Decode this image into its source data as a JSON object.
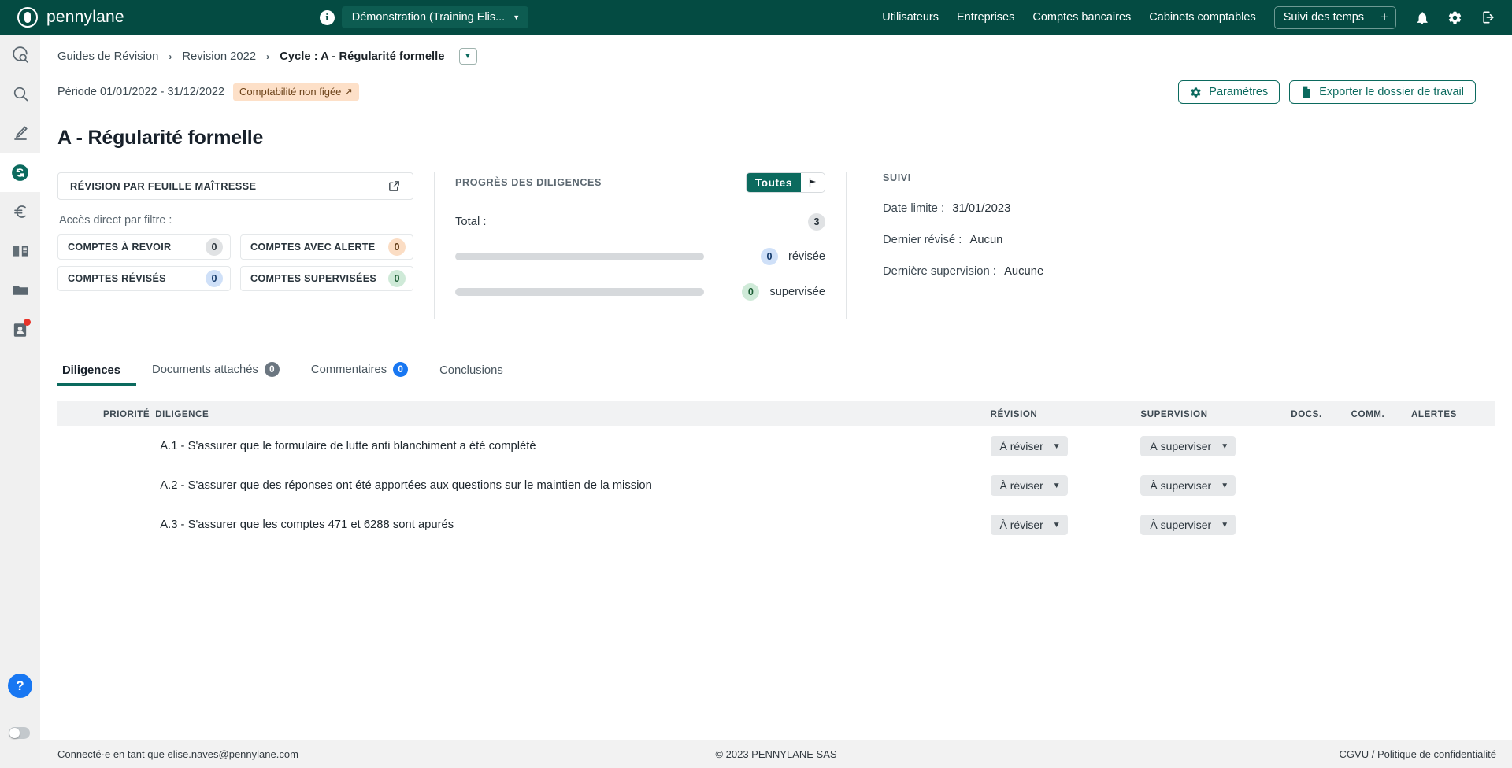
{
  "topbar": {
    "brand": "pennylane",
    "org_selector": "Démonstration (Training Elis...",
    "nav": [
      {
        "label": "Utilisateurs"
      },
      {
        "label": "Entreprises"
      },
      {
        "label": "Comptes bancaires"
      },
      {
        "label": "Cabinets comptables"
      }
    ],
    "time_tracking_label": "Suivi des temps",
    "time_tracking_plus": "+",
    "icons": [
      "info-icon",
      "bell-icon",
      "gear-icon",
      "logout-icon"
    ],
    "background": "#044b42"
  },
  "rail": {
    "items": [
      {
        "name": "review-search-icon",
        "active": false
      },
      {
        "name": "search-icon",
        "active": false
      },
      {
        "name": "pen-icon",
        "active": false
      },
      {
        "name": "revision-cycle-icon",
        "active": true
      },
      {
        "name": "euro-icon",
        "active": false
      },
      {
        "name": "book-icon",
        "active": false
      },
      {
        "name": "folder-icon",
        "active": false
      },
      {
        "name": "contact-icon",
        "active": false,
        "badge": true
      }
    ],
    "help_label": "?",
    "accent": "#0b6a5e"
  },
  "breadcrumb": {
    "items": [
      "Guides de Révision",
      "Revision 2022"
    ],
    "current": "Cycle : A - Régularité formelle",
    "separator": "›"
  },
  "period": {
    "text": "Période 01/01/2022 - 31/12/2022",
    "badge": "Comptabilité non figée ↗",
    "badge_color": "#fde0c8"
  },
  "actions": {
    "settings": "Paramètres",
    "export": "Exporter le dossier de travail"
  },
  "page_title": "A - Régularité formelle",
  "sheet_panel": {
    "title": "RÉVISION PAR FEUILLE MAÎTRESSE",
    "filter_label": "Accès direct par filtre :",
    "filters": [
      {
        "label": "COMPTES À REVOIR",
        "count": "0",
        "tone": "grey"
      },
      {
        "label": "COMPTES AVEC ALERTE",
        "count": "0",
        "tone": "orange"
      },
      {
        "label": "COMPTES RÉVISÉS",
        "count": "0",
        "tone": "blue"
      },
      {
        "label": "COMPTES SUPERVISÉES",
        "count": "0",
        "tone": "green"
      }
    ]
  },
  "progress_panel": {
    "title": "PROGRÈS DES DILIGENCES",
    "toggle_label": "Toutes",
    "total_label": "Total :",
    "total_value": "3",
    "bars": [
      {
        "count": "0",
        "label": "révisée",
        "tone": "blue",
        "percent": 0
      },
      {
        "count": "0",
        "label": "supervisée",
        "tone": "green",
        "percent": 0
      }
    ]
  },
  "suivi_panel": {
    "title": "SUIVI",
    "rows": [
      {
        "label": "Date limite :",
        "value": "31/01/2023"
      },
      {
        "label": "Dernier révisé :",
        "value": "Aucun"
      },
      {
        "label": "Dernière supervision :",
        "value": "Aucune"
      }
    ]
  },
  "tabs": [
    {
      "label": "Diligences",
      "badge": null,
      "tone": null,
      "active": true
    },
    {
      "label": "Documents attachés",
      "badge": "0",
      "tone": "grey",
      "active": false
    },
    {
      "label": "Commentaires",
      "badge": "0",
      "tone": "blue",
      "active": false
    },
    {
      "label": "Conclusions",
      "badge": null,
      "tone": null,
      "active": false
    }
  ],
  "table": {
    "columns": [
      "PRIORITÉ",
      "DILIGENCE",
      "RÉVISION",
      "SUPERVISION",
      "DOCS.",
      "COMM.",
      "ALERTES"
    ],
    "rows": [
      {
        "priority": "",
        "diligence": "A.1 - S'assurer que le formulaire de lutte anti blanchiment a été complété",
        "revision": "À réviser",
        "supervision": "À superviser",
        "docs": "",
        "comm": "",
        "alertes": ""
      },
      {
        "priority": "",
        "diligence": "A.2 - S'assurer que des réponses ont été apportées aux questions sur le maintien de la mission",
        "revision": "À réviser",
        "supervision": "À superviser",
        "docs": "",
        "comm": "",
        "alertes": ""
      },
      {
        "priority": "",
        "diligence": "A.3 - S'assurer que les comptes 471 et 6288 sont apurés",
        "revision": "À réviser",
        "supervision": "À superviser",
        "docs": "",
        "comm": "",
        "alertes": ""
      }
    ]
  },
  "footer": {
    "left": "Connecté·e en tant que elise.naves@pennylane.com",
    "center": "© 2023 PENNYLANE SAS",
    "link_cgvu": "CGVU",
    "link_sep": " / ",
    "link_privacy": "Politique de confidentialité"
  }
}
